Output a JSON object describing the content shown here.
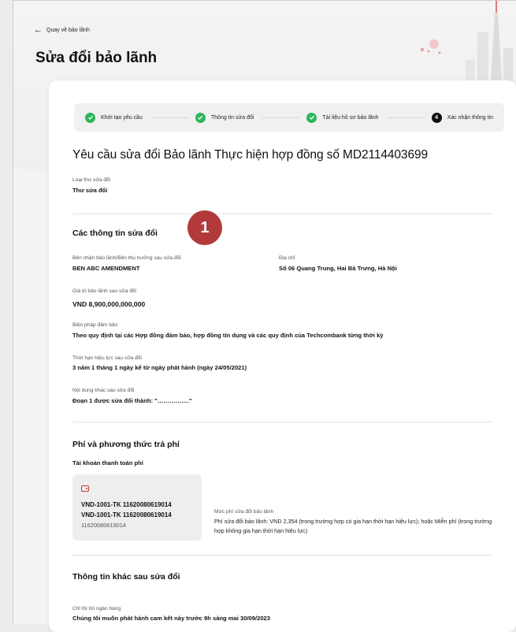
{
  "nav": {
    "back_label": "Quay về bảo lãnh"
  },
  "page": {
    "title": "Sửa đổi bảo lãnh"
  },
  "stepper": {
    "steps": [
      {
        "label": "Khởi tạo yêu cầu",
        "state": "done"
      },
      {
        "label": "Thông tin sửa đổi",
        "state": "done"
      },
      {
        "label": "Tài liệu hồ sơ bảo lãnh",
        "state": "done"
      },
      {
        "label": "Xác nhận thông tin",
        "state": "current",
        "number": "4"
      }
    ]
  },
  "request_title": "Yêu cầu sửa đổi Bảo lãnh Thực hiện hợp đồng số MD2114403699",
  "letter_type": {
    "label": "Loại thư sửa đổi",
    "value": "Thư sửa đổi"
  },
  "annotation_badge": "1",
  "amend_section": {
    "title": "Các thông tin sửa đổi",
    "beneficiary_label": "Bên nhận bảo lãnh/Bên thụ hưởng sau sửa đổi",
    "beneficiary_value": "BEN ABC AMENDMENT",
    "address_label": "Địa chỉ",
    "address_value": "Số 06 Quang Trung, Hai Bà Trưng, Hà Nội",
    "amount_label": "Giá trị bảo lãnh sau sửa đổi",
    "amount_value": "VND 8,900,000,000,000",
    "security_label": "Biện pháp đảm bảo",
    "security_value": "Theo quy định tại các Hợp đồng đảm bảo, hợp đồng tín dụng và các quy định của Techcombank từng thời kỳ",
    "validity_label": "Thời hạn hiệu lực sau sửa đổi",
    "validity_value": "3 năm 1 tháng 1 ngày kể từ ngày phát hành (ngày 24/05/2021)",
    "other_label": "Nội dung khác sau sửa đổi",
    "other_value": "Đoạn 1 được sửa đổi thành: \"…………….\""
  },
  "fee_section": {
    "title": "Phí và phương thức trả phí",
    "account_heading": "Tài khoản thanh toán phí",
    "account_line1": "VND-1001-TK 11620080619014",
    "account_line2": "VND-1001-TK 11620080619014",
    "account_line3": "11620080619014",
    "fee_label": "Mức phí sửa đổi bảo lãnh",
    "fee_text": "Phí sửa đổi bảo lãnh: VND 2,354 (trong trường hợp có gia hạn thời hạn hiệu lực); hoặc Miễn phí (trong trường hợp không gia hạn thời hạn hiệu lực)"
  },
  "other_section": {
    "title": "Thông tin khác sau sửa đổi",
    "instruction_label": "Chỉ thị tới ngân hàng",
    "instruction_value": "Chúng tôi muốn phát hành cam kết này trước 9h sáng mai 30/09/2023"
  },
  "colors": {
    "success": "#2fb55b",
    "brand_red": "#c8343c",
    "badge": "#b23a3a"
  }
}
